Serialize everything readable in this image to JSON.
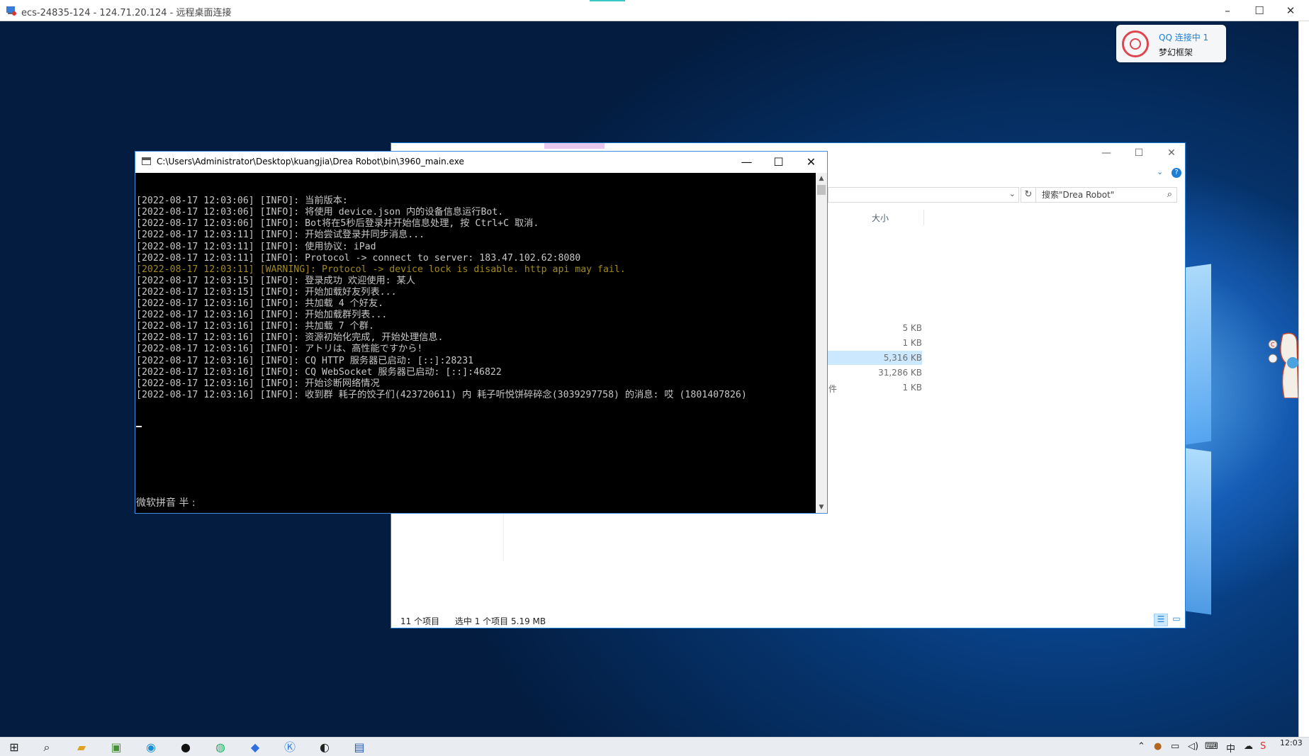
{
  "rdp": {
    "title": "ecs-24835-124 - 124.71.20.124 - 远程桌面连接",
    "min_icon": "minimize-icon",
    "max_icon": "maximize-icon",
    "close_icon": "close-icon"
  },
  "toast": {
    "icon": "qq-logo-icon",
    "status": "QQ 连接中 1",
    "name": "梦幻框架"
  },
  "explorer": {
    "search_placeholder": "搜索\"Drea Robot\"",
    "column_size": "大小",
    "sizes": [
      "5 KB",
      "1 KB",
      "5,316 KB",
      "31,286 KB",
      "1 KB"
    ],
    "partial_type": "件",
    "status_count": "11 个项目",
    "status_selection": "选中 1 个项目  5.19 MB",
    "help": "?",
    "refresh_icon": "refresh-icon",
    "search_icon": "search-icon"
  },
  "console": {
    "title": "C:\\Users\\Administrator\\Desktop\\kuangjia\\Drea Robot\\bin\\3960_main.exe",
    "lines": [
      "[2022-08-17 12:03:06] [INFO]: 当前版本:",
      "[2022-08-17 12:03:06] [INFO]: 将使用 device.json 内的设备信息运行Bot.",
      "[2022-08-17 12:03:06] [INFO]: Bot将在5秒后登录并开始信息处理, 按 Ctrl+C 取消.",
      "[2022-08-17 12:03:11] [INFO]: 开始尝试登录并同步消息...",
      "[2022-08-17 12:03:11] [INFO]: 使用协议: iPad",
      "[2022-08-17 12:03:11] [INFO]: Protocol -> connect to server: 183.47.102.62:8080",
      "[2022-08-17 12:03:11] [WARNING]: Protocol -> device lock is disable. http api may fail.",
      "[2022-08-17 12:03:15] [INFO]: 登录成功 欢迎使用: 某人",
      "[2022-08-17 12:03:15] [INFO]: 开始加载好友列表...",
      "[2022-08-17 12:03:16] [INFO]: 共加载 4 个好友.",
      "[2022-08-17 12:03:16] [INFO]: 开始加载群列表...",
      "[2022-08-17 12:03:16] [INFO]: 共加载 7 个群.",
      "[2022-08-17 12:03:16] [INFO]: 资源初始化完成, 开始处理信息.",
      "[2022-08-17 12:03:16] [INFO]: アトリは、高性能ですから!",
      "[2022-08-17 12:03:16] [INFO]: CQ HTTP 服务器已启动: [::]:28231",
      "[2022-08-17 12:03:16] [INFO]: CQ WebSocket 服务器已启动: [::]:46822",
      "[2022-08-17 12:03:16] [INFO]: 开始诊断网络情况",
      "[2022-08-17 12:03:16] [INFO]: 收到群 耗子的饺子们(423720611) 内 耗子听悦饼碎碎念(3039297758) 的消息: 哎 (1801407826)"
    ],
    "warning_line_index": 6,
    "ime_status": "微软拼音 半 :",
    "min_glyph": "—",
    "max_glyph": "☐",
    "close_glyph": "✕"
  },
  "taskbar": {
    "apps": [
      "start-icon",
      "search-icon",
      "file-explorer-icon",
      "app-icon",
      "edge-icon",
      "qq-icon",
      "wechat-icon",
      "feishu-icon",
      "app-k-icon",
      "steam-icon",
      "remote-desktop-icon"
    ],
    "clock": "12:03"
  }
}
